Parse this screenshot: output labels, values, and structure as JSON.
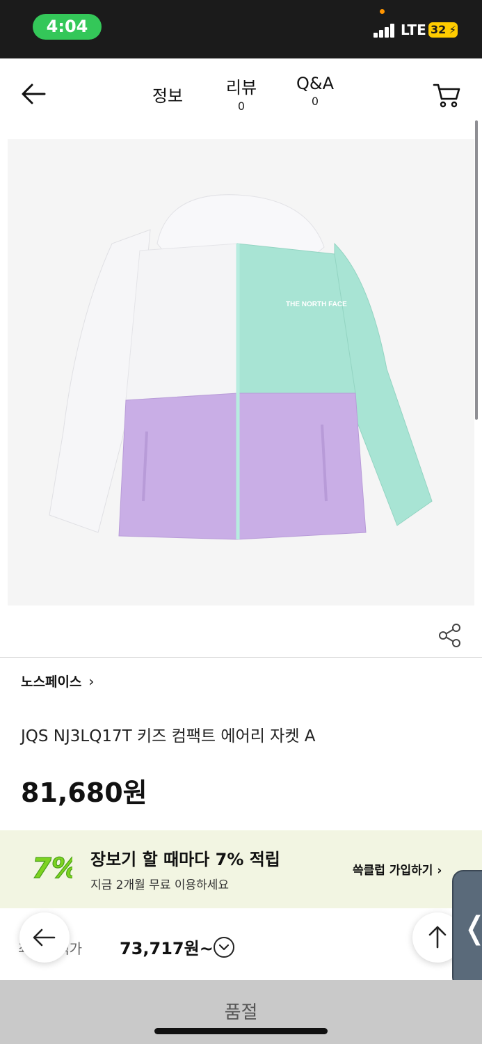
{
  "status_bar": {
    "time": "4:04",
    "network": "LTE",
    "battery": "32",
    "colors": {
      "time_pill": "#34c759",
      "battery": "#ffcc00",
      "dot": "#ff9500"
    }
  },
  "nav": {
    "tabs": [
      {
        "label": "정보",
        "count": ""
      },
      {
        "label": "리뷰",
        "count": "0"
      },
      {
        "label": "Q&A",
        "count": "0"
      }
    ]
  },
  "product": {
    "image_icon": "hooded-jacket-image",
    "brand": "노스페이스",
    "brand_chevron": "›",
    "name": "JQS NJ3LQ17T 키즈 컴팩트 에어리 자켓 A",
    "price": "81,680원",
    "jacket_colors": {
      "white": "#f4f4f6",
      "mint": "#a8e4d4",
      "lavender": "#c9aee6"
    }
  },
  "promo": {
    "badge": "7%",
    "title": "장보기 할 때마다 7% 적립",
    "subtitle": "지금 2개월 무료 이용하세요",
    "link": "쓱클럽 가입하기 ›",
    "badge_color": "#7ed321"
  },
  "benefit": {
    "label": "최대혜택가",
    "price": "73,717원~"
  },
  "bottom": {
    "sold_out_label": "품절"
  }
}
